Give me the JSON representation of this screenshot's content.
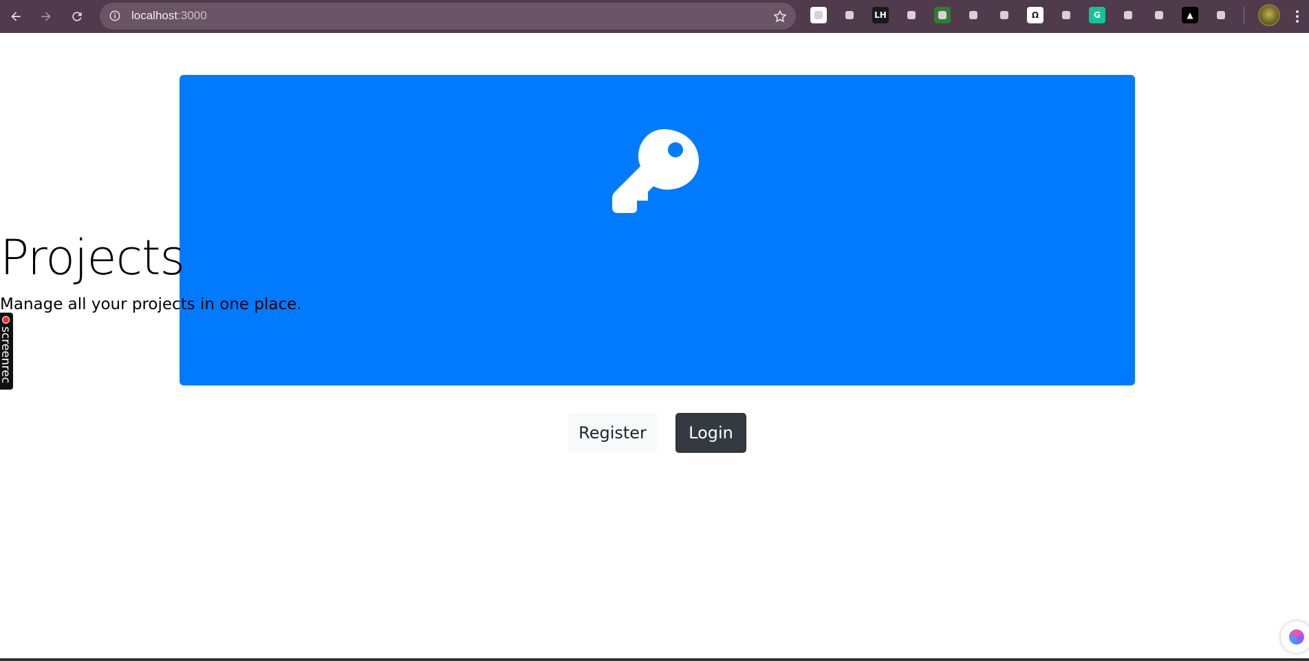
{
  "browser": {
    "url_host": "localhost",
    "url_port": ":3000",
    "extensions": [
      {
        "name": "ext-strip-icon",
        "label": "",
        "bg": "#ffffff"
      },
      {
        "name": "ext-dropper-icon",
        "label": "",
        "bg": "#4f3b4b"
      },
      {
        "name": "ext-lighthouse-icon",
        "label": "LH",
        "bg": "#1a1a1a"
      },
      {
        "name": "ext-rocket-icon",
        "label": "",
        "bg": "#4f3b4b"
      },
      {
        "name": "ext-tree-icon",
        "label": "",
        "bg": "#2e7d32"
      },
      {
        "name": "ext-play-icon",
        "label": "",
        "bg": "#4f3b4b"
      },
      {
        "name": "ext-turtle-icon",
        "label": "",
        "bg": "#4f3b4b"
      },
      {
        "name": "ext-omega-icon",
        "label": "Ω",
        "bg": "#ffffff"
      },
      {
        "name": "ext-window-icon",
        "label": "",
        "bg": "#4f3b4b"
      },
      {
        "name": "ext-grammarly-icon",
        "label": "G",
        "bg": "#15c39a"
      },
      {
        "name": "ext-brain-icon",
        "label": "",
        "bg": "#4f3b4b"
      },
      {
        "name": "ext-highlighter-icon",
        "label": "",
        "bg": "#4f3b4b"
      },
      {
        "name": "ext-triangle-icon",
        "label": "▲",
        "bg": "#000000"
      },
      {
        "name": "extensions-puzzle-icon",
        "label": "",
        "bg": "#4f3b4b"
      }
    ]
  },
  "hero": {
    "title": "Projects",
    "subtitle": "Manage all your projects in one place.",
    "icon": "key-icon",
    "background": "#007bff"
  },
  "actions": {
    "register_label": "Register",
    "login_label": "Login"
  },
  "overlay": {
    "screenrec_label": "screenrec"
  }
}
